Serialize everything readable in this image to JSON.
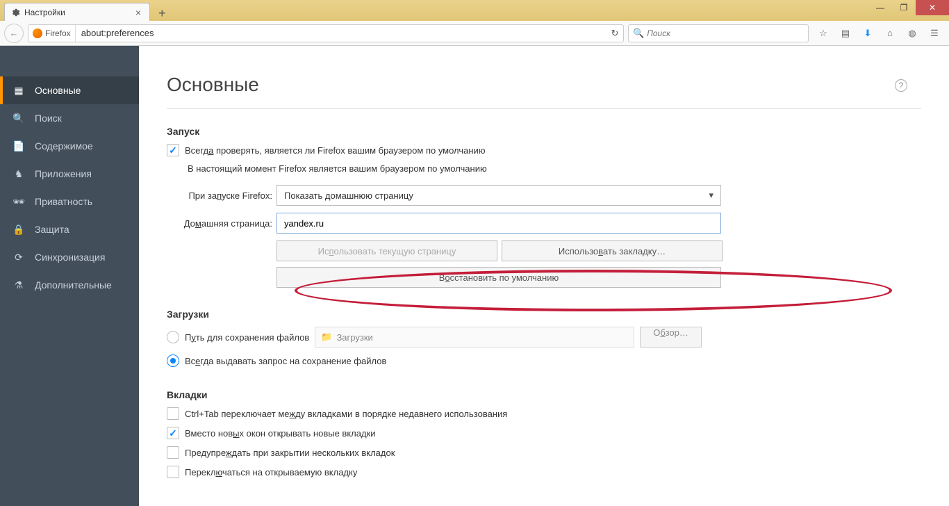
{
  "window": {
    "tab_title": "Настройки",
    "url_identity": "Firefox",
    "url": "about:preferences",
    "search_placeholder": "Поиск"
  },
  "sidebar": {
    "items": [
      {
        "label": "Основные"
      },
      {
        "label": "Поиск"
      },
      {
        "label": "Содержимое"
      },
      {
        "label": "Приложения"
      },
      {
        "label": "Приватность"
      },
      {
        "label": "Защита"
      },
      {
        "label": "Синхронизация"
      },
      {
        "label": "Дополнительные"
      }
    ]
  },
  "main": {
    "title": "Основные",
    "startup": {
      "heading": "Запуск",
      "always_check": "Всегда проверять, является ли Firefox вашим браузером по умолчанию",
      "default_status": "В настоящий момент Firefox является вашим браузером по умолчанию",
      "on_startup_label": "При запуске Firefox:",
      "on_startup_value": "Показать домашнюю страницу",
      "homepage_label": "Домашняя страница:",
      "homepage_value": "yandex.ru",
      "use_current": "Использовать текущую страницу",
      "use_bookmark": "Использовать закладку…",
      "restore_default": "Восстановить по умолчанию"
    },
    "downloads": {
      "heading": "Загрузки",
      "save_to_label": "Путь для сохранения файлов",
      "path_placeholder": "Загрузки",
      "browse": "Обзор…",
      "always_ask": "Всегда выдавать запрос на сохранение файлов"
    },
    "tabs": {
      "heading": "Вкладки",
      "ctrl_tab": "Ctrl+Tab переключает между вкладками в порядке недавнего использования",
      "new_windows": "Вместо новых окон открывать новые вкладки",
      "warn_close": "Предупреждать при закрытии нескольких вкладок",
      "switch_new": "Переключаться на открываемую вкладку"
    }
  }
}
